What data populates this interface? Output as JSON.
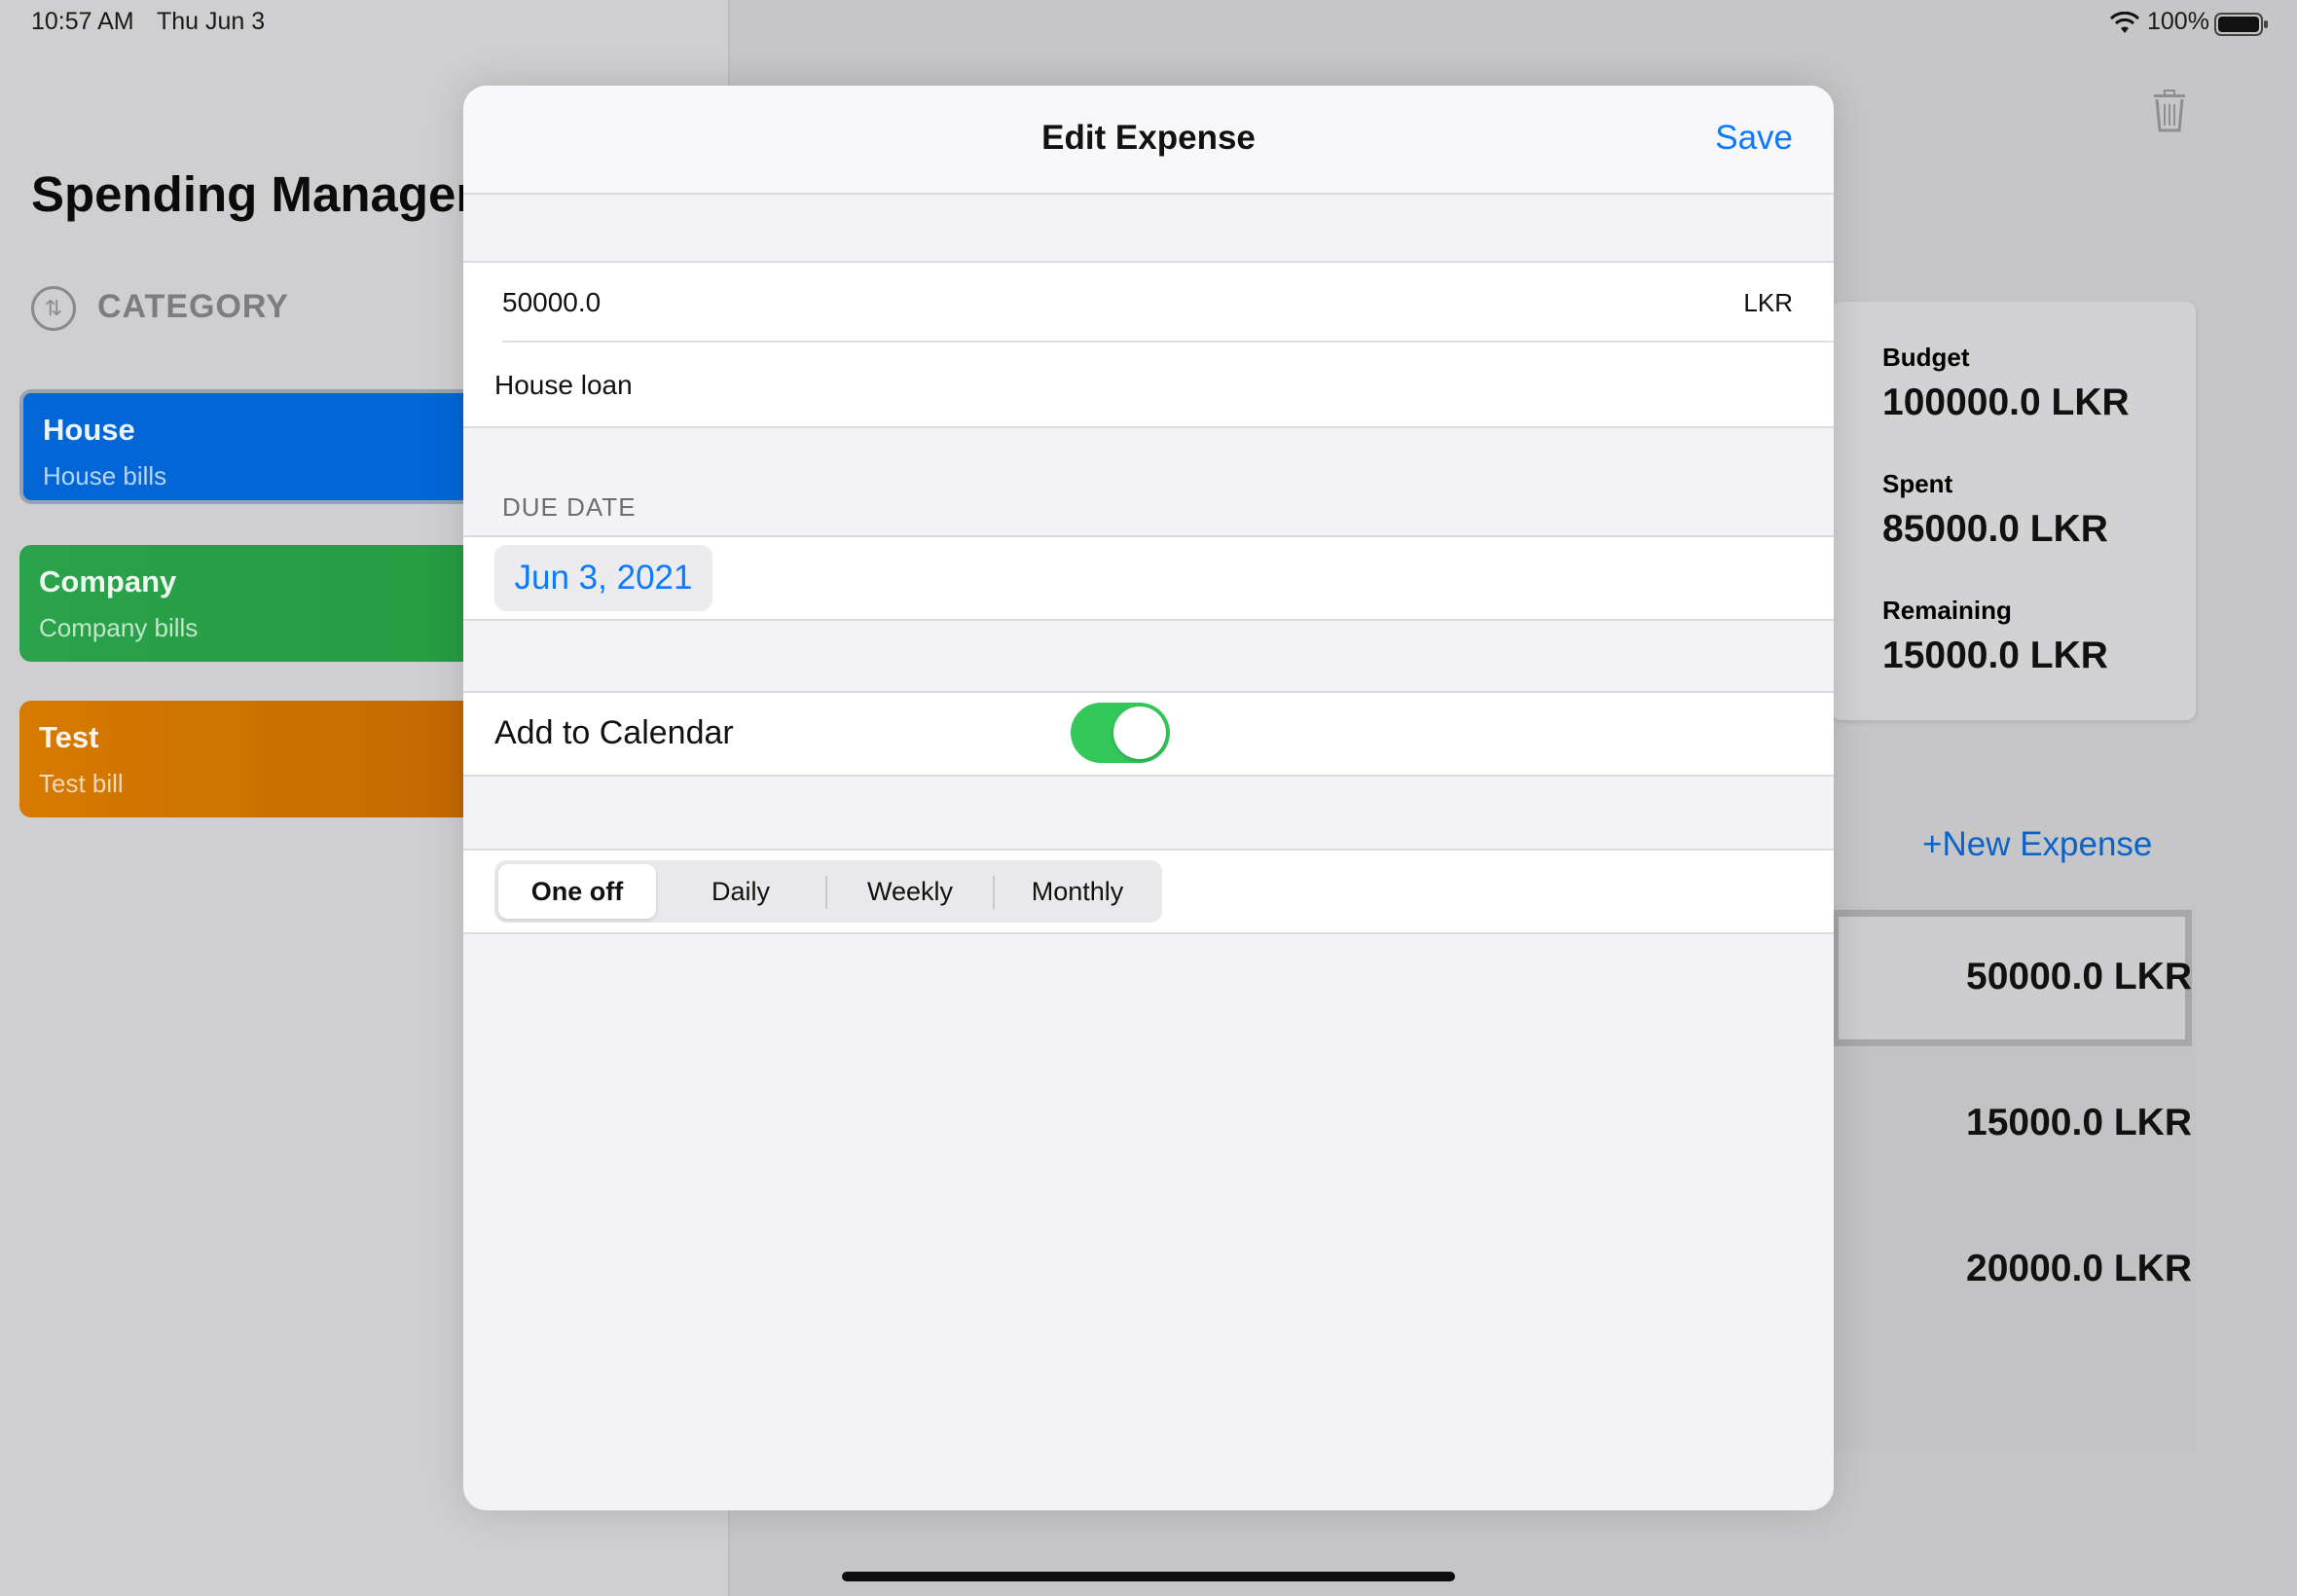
{
  "status_bar": {
    "time": "10:57 AM",
    "date": "Thu Jun 3",
    "battery_pct": "100%",
    "icons": [
      "wifi-icon",
      "battery-icon"
    ]
  },
  "sidebar": {
    "title": "Spending Managem",
    "category_header": "CATEGORY",
    "categories": [
      {
        "title": "House",
        "subtitle": "House bills",
        "color": "#0366d6",
        "selected": true
      },
      {
        "title": "Company",
        "subtitle": "Company bills",
        "color": "#27a047"
      },
      {
        "title": "Test",
        "subtitle": "Test bill",
        "color": "#d77a00"
      }
    ]
  },
  "detail": {
    "budget_label": "Budget",
    "budget_value": "100000.0 LKR",
    "spent_label": "Spent",
    "spent_value": "85000.0 LKR",
    "remaining_label": "Remaining",
    "remaining_value": "15000.0 LKR",
    "new_expense_label": "New Expense",
    "expenses": [
      "50000.0 LKR",
      "15000.0 LKR",
      "20000.0 LKR"
    ],
    "colors": {
      "budget": "#0a64c8",
      "spent": "#c8281e",
      "remaining": "#229a4a"
    }
  },
  "modal": {
    "title": "Edit Expense",
    "save_label": "Save",
    "amount_value": "50000.0",
    "currency": "LKR",
    "description_value": "House loan",
    "due_date_header": "DUE DATE",
    "due_date_value": "Jun 3, 2021",
    "add_to_calendar_label": "Add to Calendar",
    "add_to_calendar_on": true,
    "recurrence_options": [
      "One off",
      "Daily",
      "Weekly",
      "Monthly"
    ],
    "recurrence_selected": "One off"
  }
}
